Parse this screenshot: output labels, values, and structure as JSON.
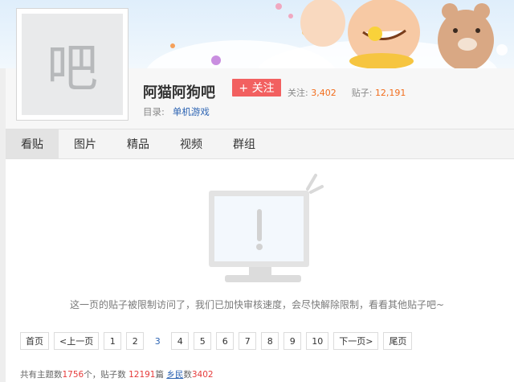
{
  "forum": {
    "avatar_char": "吧",
    "name": "阿猫阿狗吧",
    "follow_label": "+ 关注",
    "followers_label": "关注:",
    "followers_value": "3,402",
    "posts_label": "贴子:",
    "posts_value": "12,191",
    "directory_label": "目录:",
    "directory_value": "单机游戏"
  },
  "tabs": [
    {
      "label": "看贴",
      "active": true
    },
    {
      "label": "图片",
      "active": false
    },
    {
      "label": "精品",
      "active": false
    },
    {
      "label": "视频",
      "active": false
    },
    {
      "label": "群组",
      "active": false
    }
  ],
  "empty_state": {
    "message": "这一页的贴子被限制访问了，我们已加快审核速度，会尽快解除限制，看看其他贴子吧~"
  },
  "pagination": {
    "first": "首页",
    "prev": "<上一页",
    "pages": [
      "1",
      "2",
      "3",
      "4",
      "5",
      "6",
      "7",
      "8",
      "9",
      "10"
    ],
    "current": "3",
    "next": "下一页>",
    "last": "尾页"
  },
  "summary": {
    "topics_prefix": "共有主题数",
    "topics_value": "1756",
    "topics_unit": "个，贴子数 ",
    "posts_value": "12191",
    "posts_unit": "篇 ",
    "members_label": "乡民",
    "members_prefix": "数",
    "members_value": "3402"
  },
  "colors": {
    "follow_button": "#f26060",
    "link": "#2d64b3",
    "count_orange": "#f26d1c",
    "summary_red": "#e63b3b"
  }
}
